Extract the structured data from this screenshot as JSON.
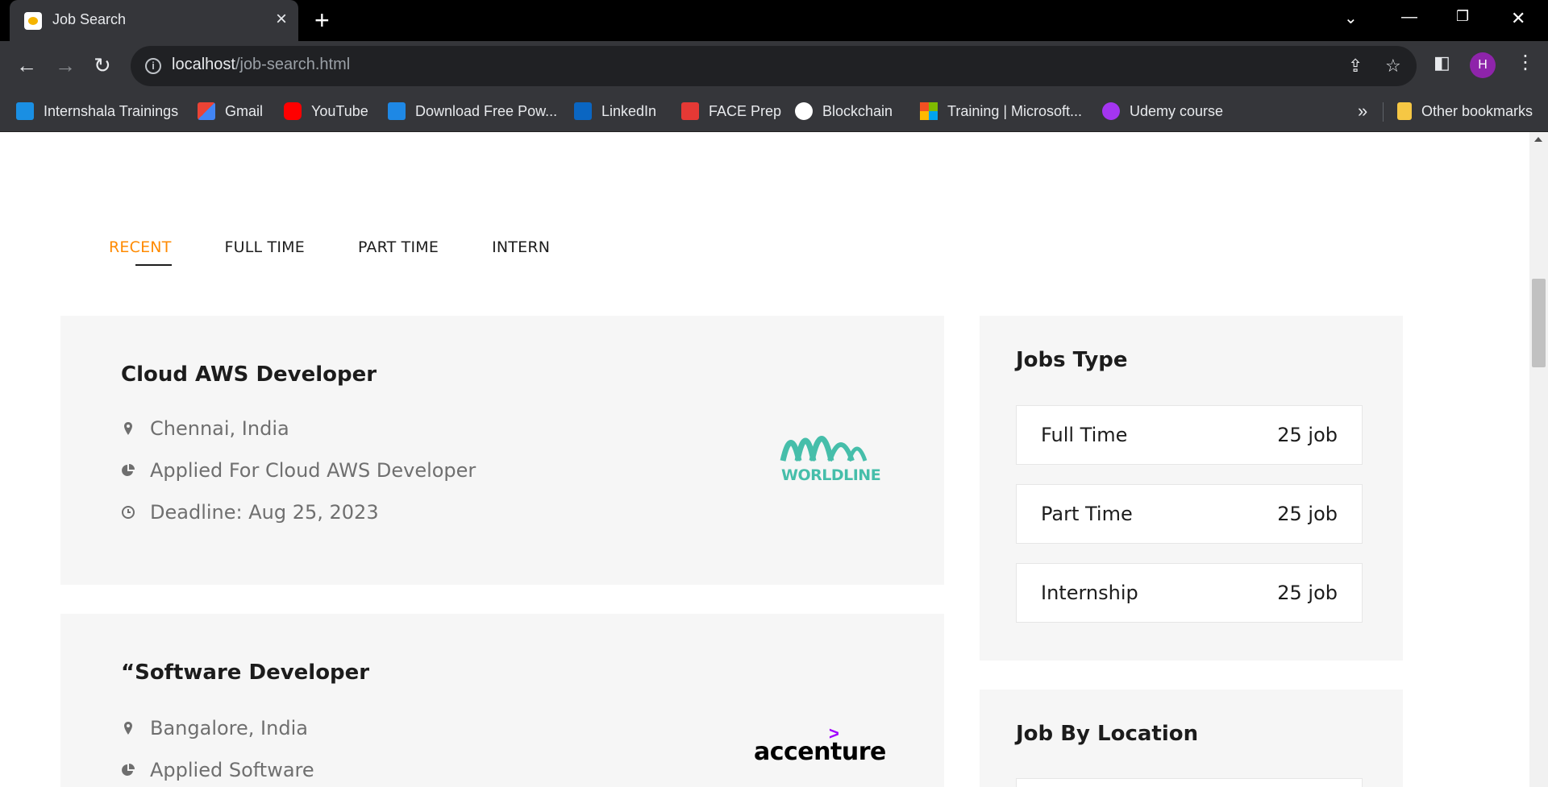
{
  "browser": {
    "tab_title": "Job Search",
    "url_host": "localhost",
    "url_path": "/job-search.html",
    "profile_initial": "H",
    "bookmarks": [
      {
        "label": "Internshala Trainings",
        "icon": "internshala-icon",
        "color": "#1a8fe3"
      },
      {
        "label": "Gmail",
        "icon": "gmail-icon",
        "color": "#ea4335"
      },
      {
        "label": "YouTube",
        "icon": "youtube-icon",
        "color": "#ff0000"
      },
      {
        "label": "Download Free Pow...",
        "icon": "download-icon",
        "color": "#1e88e5"
      },
      {
        "label": "LinkedIn",
        "icon": "linkedin-icon",
        "color": "#0a66c2"
      },
      {
        "label": "FACE Prep",
        "icon": "faceprep-icon",
        "color": "#e53935"
      },
      {
        "label": "Blockchain",
        "icon": "globe-icon",
        "color": "#ffffff"
      },
      {
        "label": "Training | Microsoft...",
        "icon": "microsoft-icon",
        "color": "#f25022"
      },
      {
        "label": "Udemy course",
        "icon": "udemy-icon",
        "color": "#a435f0"
      }
    ],
    "other_bookmarks": "Other bookmarks",
    "more_bookmarks": "»"
  },
  "filters": {
    "tabs": [
      "RECENT",
      "FULL TIME",
      "PART TIME",
      "INTERN"
    ],
    "active": "RECENT",
    "accent_color": "#ff8a00"
  },
  "jobs": [
    {
      "title": "Cloud AWS Developer",
      "location": "Chennai, India",
      "applied": "Applied For Cloud AWS Developer",
      "deadline": "Deadline: Aug 25, 2023",
      "company_logo_text": "WORLDLINE",
      "logo_color": "#46beaa"
    },
    {
      "title": "“Software Developer",
      "location": "Bangalore, India",
      "applied": "Applied Software",
      "company_logo_text": "accenture",
      "logo_color": "#a100ff"
    }
  ],
  "jobs_type": {
    "heading": "Jobs Type",
    "items": [
      {
        "label": "Full Time",
        "count": "25 job"
      },
      {
        "label": "Part Time",
        "count": "25 job"
      },
      {
        "label": "Internship",
        "count": "25 job"
      }
    ]
  },
  "job_by_location": {
    "heading": "Job By Location"
  }
}
